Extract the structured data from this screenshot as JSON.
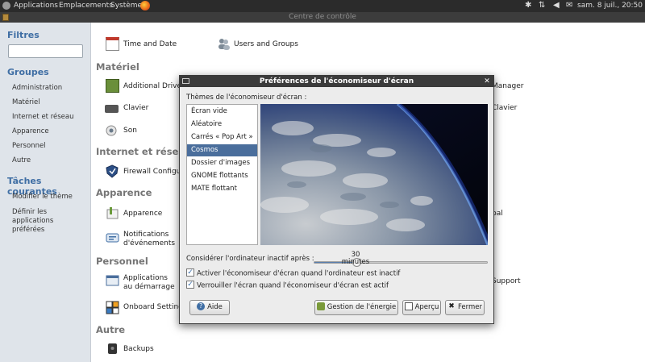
{
  "top_panel": {
    "menus": [
      "Applications",
      "Emplacements",
      "Système"
    ],
    "clock": "sam. 8 juil., 20:50"
  },
  "window": {
    "title": "Centre de contrôle"
  },
  "sidebar": {
    "filter_heading": "Filtres",
    "filter_value": "",
    "groups_heading": "Groupes",
    "groups": [
      "Administration",
      "Matériel",
      "Internet et réseau",
      "Apparence",
      "Personnel",
      "Autre"
    ],
    "tasks_heading": "Tâches courantes",
    "tasks": [
      "Modifier le thème",
      "Définir les applications préférées"
    ]
  },
  "main": {
    "categories": [
      "Matériel",
      "Internet et réseau",
      "Apparence",
      "Personnel",
      "Autre"
    ],
    "items": {
      "time_date": "Time and Date",
      "users_groups": "Users and Groups",
      "additional_drivers": "Additional Drivers",
      "clavier": "Clavier",
      "son": "Son",
      "firewall": "Firewall Configuration",
      "apparence": "Apparence",
      "notifications": "Notifications d'événements",
      "apps_demarrage": "Applications au démarrage",
      "onboard": "Onboard Settings",
      "backups": "Backups",
      "right_manager": "Manager",
      "right_clavier": "Clavier",
      "right_pal": "pal",
      "right_support": "Support"
    }
  },
  "dialog": {
    "title": "Préférences de l'économiseur d'écran",
    "themes_label": "Thèmes de l'économiseur d'écran :",
    "themes": [
      "Écran vide",
      "Aléatoire",
      "Carrés « Pop Art »",
      "Cosmos",
      "Dossier d'images",
      "GNOME flottants",
      "MATE flottant"
    ],
    "selected_theme": "Cosmos",
    "idle_label": "Considérer l'ordinateur inactif après :",
    "idle_value": "30 minutes",
    "idle_fraction": 0.25,
    "check_activate": "Activer l'économiseur d'écran quand l'ordinateur est inactif",
    "check_lock": "Verrouiller l'écran quand l'économiseur d'écran est actif",
    "btn_help": "Aide",
    "btn_power": "Gestion de l'énergie",
    "btn_preview": "Aperçu",
    "btn_close": "Fermer"
  },
  "colors": {
    "accent": "#3f6ea4",
    "selection": "#4a6e9c",
    "panel": "#2b2b2b"
  }
}
